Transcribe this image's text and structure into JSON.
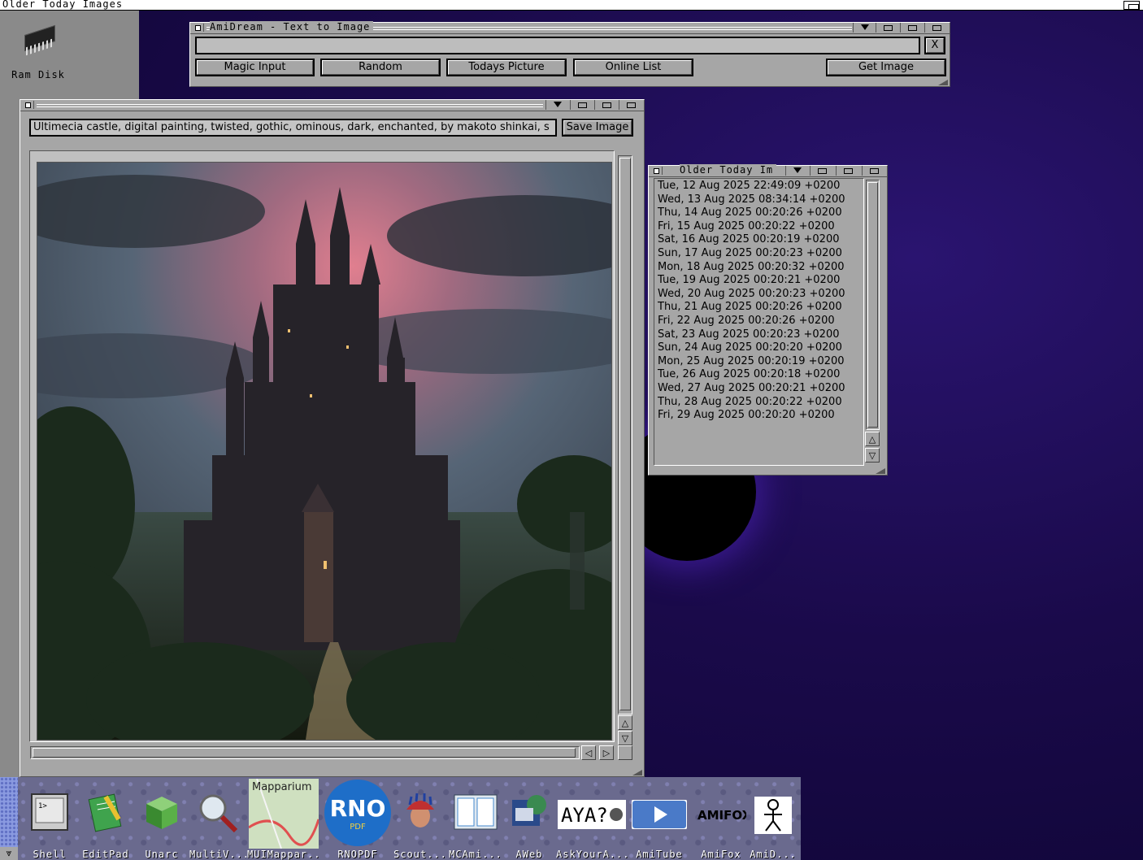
{
  "screen": {
    "title": "Older Today Images"
  },
  "desktop": {
    "icons": [
      {
        "label": "Ram Disk",
        "icon": "ram-chip-icon"
      }
    ]
  },
  "amidream": {
    "title": "AmiDream - Text to Image",
    "prompt_value": "",
    "clear_label": "X",
    "buttons": [
      "Magic Input",
      "Random",
      "Todays Picture",
      "Online List"
    ],
    "get_image_label": "Get Image"
  },
  "image_window": {
    "prompt_text": "Ultimecia castle, digital painting, twisted, gothic, ominous, dark, enchanted, by makoto shinkai, s",
    "save_label": "Save Image",
    "image_description_icon": "gothic-castle-image"
  },
  "older_window": {
    "title": "Older Today Im",
    "items": [
      "Tue, 12 Aug 2025 22:49:09 +0200",
      "Wed, 13 Aug 2025 08:34:14 +0200",
      "Thu, 14 Aug 2025 00:20:26 +0200",
      "Fri, 15 Aug 2025 00:20:22 +0200",
      "Sat, 16 Aug 2025 00:20:19 +0200",
      "Sun, 17 Aug 2025 00:20:23 +0200",
      "Mon, 18 Aug 2025 00:20:32 +0200",
      "Tue, 19 Aug 2025 00:20:21 +0200",
      "Wed, 20 Aug 2025 00:20:23 +0200",
      "Thu, 21 Aug 2025 00:20:26 +0200",
      "Fri, 22 Aug 2025 00:20:26 +0200",
      "Sat, 23 Aug 2025 00:20:23 +0200",
      "Sun, 24 Aug 2025 00:20:20 +0200",
      "Mon, 25 Aug 2025 00:20:19 +0200",
      "Tue, 26 Aug 2025 00:20:18 +0200",
      "Wed, 27 Aug 2025 00:20:21 +0200",
      "Thu, 28 Aug 2025 00:20:22 +0200",
      "Fri, 29 Aug 2025 00:20:20 +0200"
    ]
  },
  "dock": {
    "items": [
      {
        "label": "Shell",
        "icon": "shell-icon"
      },
      {
        "label": "EditPad",
        "icon": "notepad-icon"
      },
      {
        "label": "Unarc",
        "icon": "green-cube-icon"
      },
      {
        "label": "MultiV...",
        "icon": "magnifier-icon"
      },
      {
        "label": "MUIMappar...",
        "icon": "map-icon",
        "overlay": "Mapparium"
      },
      {
        "label": "RNOPDF",
        "icon": "rno-pdf-icon",
        "overlay": "RNO",
        "overlay2": "PDF"
      },
      {
        "label": "Scout...",
        "icon": "scout-icon"
      },
      {
        "label": "MCAmi...",
        "icon": "mcami-icon"
      },
      {
        "label": "AWeb",
        "icon": "aweb-icon"
      },
      {
        "label": "AskYourA...",
        "icon": "askyoura-icon",
        "overlay": "AYA?"
      },
      {
        "label": "AmiTube",
        "icon": "play-icon"
      },
      {
        "label": "AmiFox",
        "icon": "amifox-icon",
        "overlay": "AMIFOX"
      },
      {
        "label": "AmiD...",
        "icon": "stickman-icon"
      }
    ]
  },
  "colors": {
    "window_gray": "#a6a6a6",
    "desktop_purple": "#1a0a4a",
    "cursor_red": "#cc2020"
  }
}
